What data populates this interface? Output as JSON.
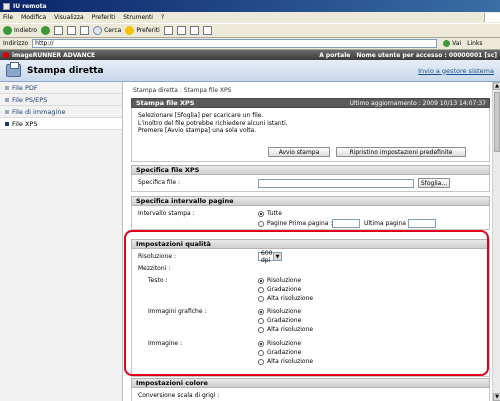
{
  "window": {
    "title": "IU remota",
    "menu": [
      "File",
      "Modifica",
      "Visualizza",
      "Preferiti",
      "Strumenti",
      "?"
    ],
    "toolbar": {
      "back": "Indietro",
      "search": "Cerca",
      "favorites": "Preferiti"
    },
    "address_label": "Indirizzo",
    "address_value": "http://",
    "go_label": "Vai",
    "links_label": "Links"
  },
  "app": {
    "brand": "imageRUNNER ADVANCE",
    "portal_link": "A portale",
    "user_label": "Nome utente per accesso : 00000001 [sc]",
    "page_title": "Stampa diretta",
    "return_link": "Invio a gestore sistema"
  },
  "sidebar": {
    "items": [
      {
        "label": "File PDF"
      },
      {
        "label": "File PS/EPS"
      },
      {
        "label": "File di immagine"
      },
      {
        "label": "File XPS"
      }
    ]
  },
  "main": {
    "breadcrumb": "Stampa diretta : Stampa file XPS",
    "print_section": {
      "title": "Stampa file XPS",
      "updated": "Ultimo aggiornamento : 2009 10/13 14:07:37",
      "message_lines": [
        "Selezionare [Sfoglia] per scaricare un file.",
        "L'inoltro del file potrebbe richiedere alcuni istanti.",
        "Premere [Avvio stampa] una sola volta."
      ],
      "start_button": "Avvio stampa",
      "reset_button": "Ripristino impostazioni predefinite"
    },
    "file_section": {
      "title": "Specifica file XPS",
      "file_label": "Specifica file :",
      "browse_button": "Sfoglia..."
    },
    "range_section": {
      "title": "Specifica intervallo pagine",
      "range_label": "Intervallo stampa :",
      "opt_all": "Tutte",
      "opt_pages": "Pagine Prima pagina :",
      "last_page_label": "Ultima pagina :"
    },
    "quality_section": {
      "title": "Impostazioni qualità",
      "resolution_label": "Risoluzione :",
      "resolution_value": "600 dpi",
      "halftone_label": "Mezzitoni :",
      "text_label": "Testo :",
      "graphics_label": "Immagini grafiche :",
      "image_label": "Immagine :",
      "opt_resolution": "Risoluzione",
      "opt_gradation": "Gradazione",
      "opt_high_resolution": "Alta risoluzione"
    },
    "color_section": {
      "title": "Impostazioni colore",
      "grayscale_label": "Conversione scala di grigi :"
    }
  },
  "colors": {
    "highlight": "#e0001b",
    "link": "#1a4f8f"
  }
}
